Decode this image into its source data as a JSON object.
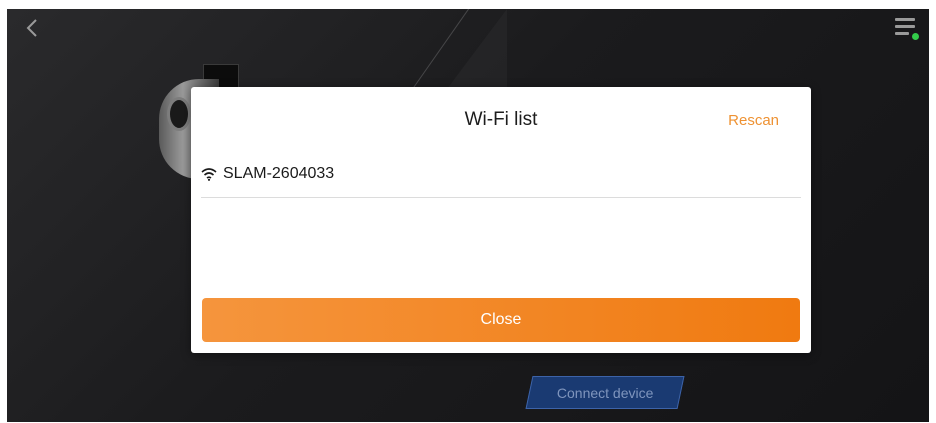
{
  "dialog": {
    "title": "Wi-Fi list",
    "rescan_label": "Rescan",
    "networks": [
      {
        "ssid": "SLAM-2604033"
      }
    ],
    "close_label": "Close"
  },
  "background": {
    "connect_label": "Connect device"
  },
  "colors": {
    "accent": "#F08019",
    "rescan": "#EE9233",
    "connect_button": "#1A3A72",
    "status_dot": "#33CC4A"
  },
  "icons": {
    "back": "chevron-left-icon",
    "menu": "hamburger-menu-icon",
    "wifi": "wifi-icon"
  }
}
